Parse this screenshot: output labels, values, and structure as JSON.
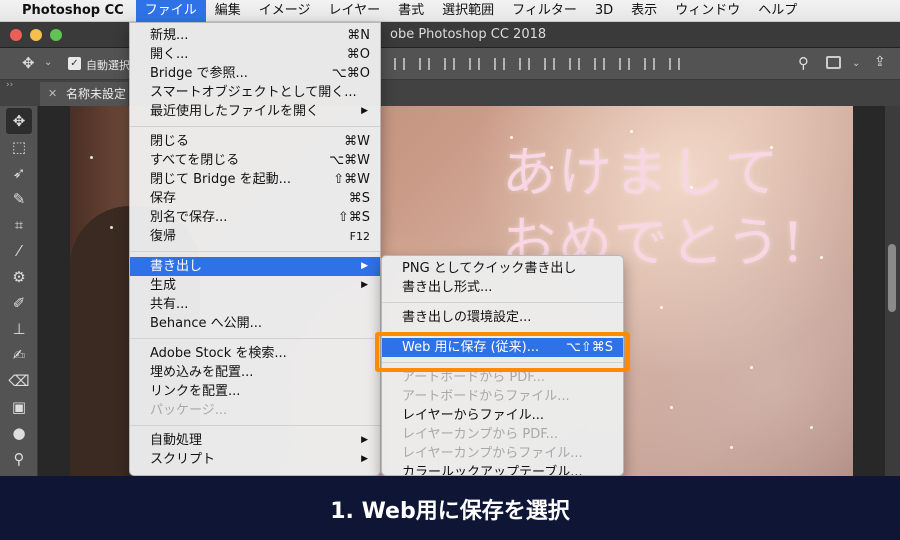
{
  "menubar": {
    "app_name": "Photoshop CC",
    "items": [
      "ファイル",
      "編集",
      "イメージ",
      "レイヤー",
      "書式",
      "選択範囲",
      "フィルター",
      "3D",
      "表示",
      "ウィンドウ",
      "ヘルプ"
    ],
    "active_index": 0
  },
  "window": {
    "title": "obe Photoshop CC 2018"
  },
  "options_bar": {
    "auto_select_label": "自動選択"
  },
  "document_tab": {
    "title": "名称未設定"
  },
  "canvas": {
    "greeting_line1": "あけまして",
    "greeting_line2": "おめでとう!"
  },
  "file_menu": {
    "group1": [
      {
        "label": "新規...",
        "shortcut": "⌘N"
      },
      {
        "label": "開く...",
        "shortcut": "⌘O"
      },
      {
        "label": "Bridge で参照...",
        "shortcut": "⌥⌘O"
      },
      {
        "label": "スマートオブジェクトとして開く...",
        "shortcut": ""
      },
      {
        "label": "最近使用したファイルを開く",
        "shortcut": "▶"
      }
    ],
    "group2": [
      {
        "label": "閉じる",
        "shortcut": "⌘W"
      },
      {
        "label": "すべてを閉じる",
        "shortcut": "⌥⌘W"
      },
      {
        "label": "閉じて Bridge を起動...",
        "shortcut": "⇧⌘W"
      },
      {
        "label": "保存",
        "shortcut": "⌘S"
      },
      {
        "label": "別名で保存...",
        "shortcut": "⇧⌘S"
      },
      {
        "label": "復帰",
        "shortcut": "F12"
      }
    ],
    "group3": [
      {
        "label": "書き出し",
        "shortcut": "▶"
      },
      {
        "label": "生成",
        "shortcut": "▶"
      },
      {
        "label": "共有...",
        "shortcut": ""
      },
      {
        "label": "Behance へ公開...",
        "shortcut": ""
      }
    ],
    "group4": [
      {
        "label": "Adobe Stock を検索...",
        "shortcut": ""
      },
      {
        "label": "埋め込みを配置...",
        "shortcut": ""
      },
      {
        "label": "リンクを配置...",
        "shortcut": ""
      },
      {
        "label": "パッケージ...",
        "shortcut": ""
      }
    ],
    "group5": [
      {
        "label": "自動処理",
        "shortcut": "▶"
      },
      {
        "label": "スクリプト",
        "shortcut": "▶"
      }
    ]
  },
  "export_submenu": {
    "group1": [
      {
        "label": "PNG としてクイック書き出し"
      },
      {
        "label": "書き出し形式..."
      }
    ],
    "group2": [
      {
        "label": "書き出しの環境設定..."
      }
    ],
    "highlighted": {
      "label": "Web 用に保存 (従来)...",
      "shortcut": "⌥⇧⌘S"
    },
    "group3": [
      {
        "label": "アートボードから PDF..."
      },
      {
        "label": "アートボードからファイル..."
      },
      {
        "label": "レイヤーからファイル..."
      },
      {
        "label": "レイヤーカンプから PDF..."
      },
      {
        "label": "レイヤーカンプからファイル..."
      },
      {
        "label": "カラールックアップテーブル..."
      }
    ]
  },
  "caption": "1. Web用に保存を選択",
  "colors": {
    "accent": "#2f71e6",
    "callout": "#ff8a00",
    "banner": "#0f1635"
  }
}
